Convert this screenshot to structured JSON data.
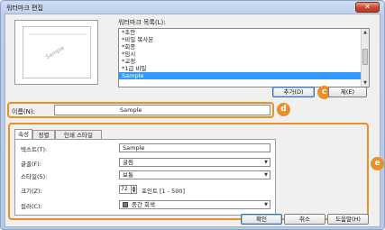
{
  "window": {
    "title": "워터마크 편집",
    "close_symbol": "✕"
  },
  "preview": {
    "watermark_text": "Sample"
  },
  "watermark_list": {
    "label": "워터마크 목록(L):",
    "items": [
      "*초안",
      "*비밀 복사본",
      "*회종",
      "*임시",
      "*교정",
      "*1급 비밀",
      "Sample"
    ],
    "selected_index": 6
  },
  "buttons": {
    "add": "추가(D)",
    "delete": "제(E)",
    "ok": "확인",
    "cancel": "취소",
    "help": "도움말(H)"
  },
  "name_field": {
    "label": "이름(N):",
    "value": "Sample"
  },
  "tabs": [
    "속성",
    "정렬",
    "인쇄 스타일"
  ],
  "active_tab": 0,
  "properties": {
    "text_label": "텍스트(T):",
    "text_value": "Sample",
    "font_label": "글꼴(F):",
    "font_value": "굴림",
    "style_label": "스타일(S):",
    "style_value": "보통",
    "size_label": "크기(Z):",
    "size_value": "72",
    "size_unit": "포인트 [1 - 500]",
    "color_label": "컬러(C):",
    "color_value": "중간 회색"
  },
  "callouts": {
    "c": "c",
    "d": "d",
    "e": "e"
  },
  "colors": {
    "callout": "#e8912a",
    "selection": "#3399ff",
    "swatch": "#777777"
  }
}
